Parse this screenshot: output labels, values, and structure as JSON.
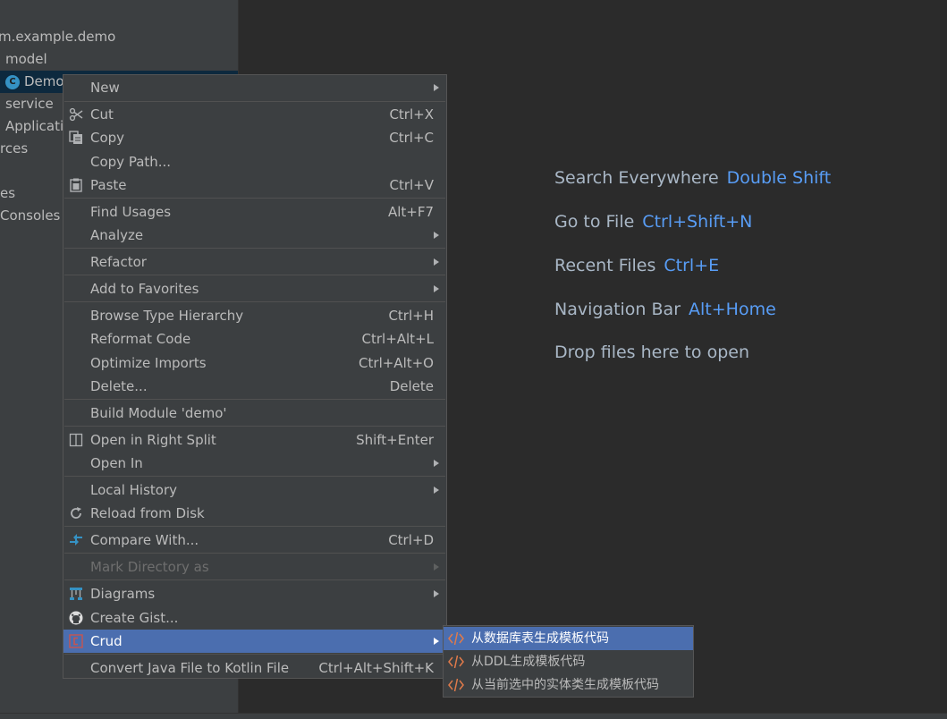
{
  "tree": {
    "items": [
      {
        "label": "m.example.demo",
        "selected": false
      },
      {
        "label": "model",
        "selected": false
      },
      {
        "label": "Demo",
        "selected": true,
        "icon": "class-icon"
      },
      {
        "label": "service",
        "selected": false
      },
      {
        "label": "Applicati",
        "selected": false
      },
      {
        "label": "rces",
        "selected": false
      },
      {
        "label": "es",
        "selected": false
      },
      {
        "label": "Consoles",
        "selected": false
      }
    ],
    "class_icon_letter": "C"
  },
  "editor_hints": [
    {
      "label": "Search Everywhere",
      "key": "Double Shift"
    },
    {
      "label": "Go to File",
      "key": "Ctrl+Shift+N"
    },
    {
      "label": "Recent Files",
      "key": "Ctrl+E"
    },
    {
      "label": "Navigation Bar",
      "key": "Alt+Home"
    },
    {
      "label": "Drop files here to open",
      "key": ""
    }
  ],
  "context_menu": {
    "items": [
      {
        "label": "New",
        "shortcut": "",
        "submenu": true
      },
      {
        "label": "Cut",
        "shortcut": "Ctrl+X",
        "icon": "scissors-icon"
      },
      {
        "label": "Copy",
        "shortcut": "Ctrl+C",
        "icon": "copy-icon"
      },
      {
        "label": "Copy Path...",
        "shortcut": ""
      },
      {
        "label": "Paste",
        "shortcut": "Ctrl+V",
        "icon": "paste-icon"
      },
      {
        "label": "Find Usages",
        "shortcut": "Alt+F7"
      },
      {
        "label": "Analyze",
        "shortcut": "",
        "submenu": true
      },
      {
        "label": "Refactor",
        "shortcut": "",
        "submenu": true
      },
      {
        "label": "Add to Favorites",
        "shortcut": "",
        "submenu": true
      },
      {
        "label": "Browse Type Hierarchy",
        "shortcut": "Ctrl+H"
      },
      {
        "label": "Reformat Code",
        "shortcut": "Ctrl+Alt+L"
      },
      {
        "label": "Optimize Imports",
        "shortcut": "Ctrl+Alt+O"
      },
      {
        "label": "Delete...",
        "shortcut": "Delete"
      },
      {
        "label": "Build Module 'demo'",
        "shortcut": ""
      },
      {
        "label": "Open in Right Split",
        "shortcut": "Shift+Enter",
        "icon": "split-icon"
      },
      {
        "label": "Open In",
        "shortcut": "",
        "submenu": true
      },
      {
        "label": "Local History",
        "shortcut": "",
        "submenu": true
      },
      {
        "label": "Reload from Disk",
        "shortcut": "",
        "icon": "reload-icon"
      },
      {
        "label": "Compare With...",
        "shortcut": "Ctrl+D",
        "icon": "compare-icon"
      },
      {
        "label": "Mark Directory as",
        "shortcut": "",
        "submenu": true,
        "disabled": true
      },
      {
        "label": "Diagrams",
        "shortcut": "",
        "submenu": true,
        "icon": "diagram-icon"
      },
      {
        "label": "Create Gist...",
        "shortcut": "",
        "icon": "github-icon"
      },
      {
        "label": "Crud",
        "shortcut": "",
        "submenu": true,
        "icon": "crud-icon",
        "active": true
      },
      {
        "label": "Convert Java File to Kotlin File",
        "shortcut": "Ctrl+Alt+Shift+K"
      }
    ]
  },
  "crud_submenu": {
    "items": [
      {
        "label": "从数据库表生成模板代码",
        "active": true
      },
      {
        "label": "从DDL生成模板代码",
        "active": false
      },
      {
        "label": "从当前选中的实体类生成模板代码",
        "active": false
      }
    ]
  },
  "colors": {
    "editor_bg": "#2b2b2b",
    "panel_bg": "#3c3f41",
    "menu_highlight": "#4b6eaf",
    "shortcut_blue": "#589df6",
    "class_icon": "#3592c4"
  }
}
